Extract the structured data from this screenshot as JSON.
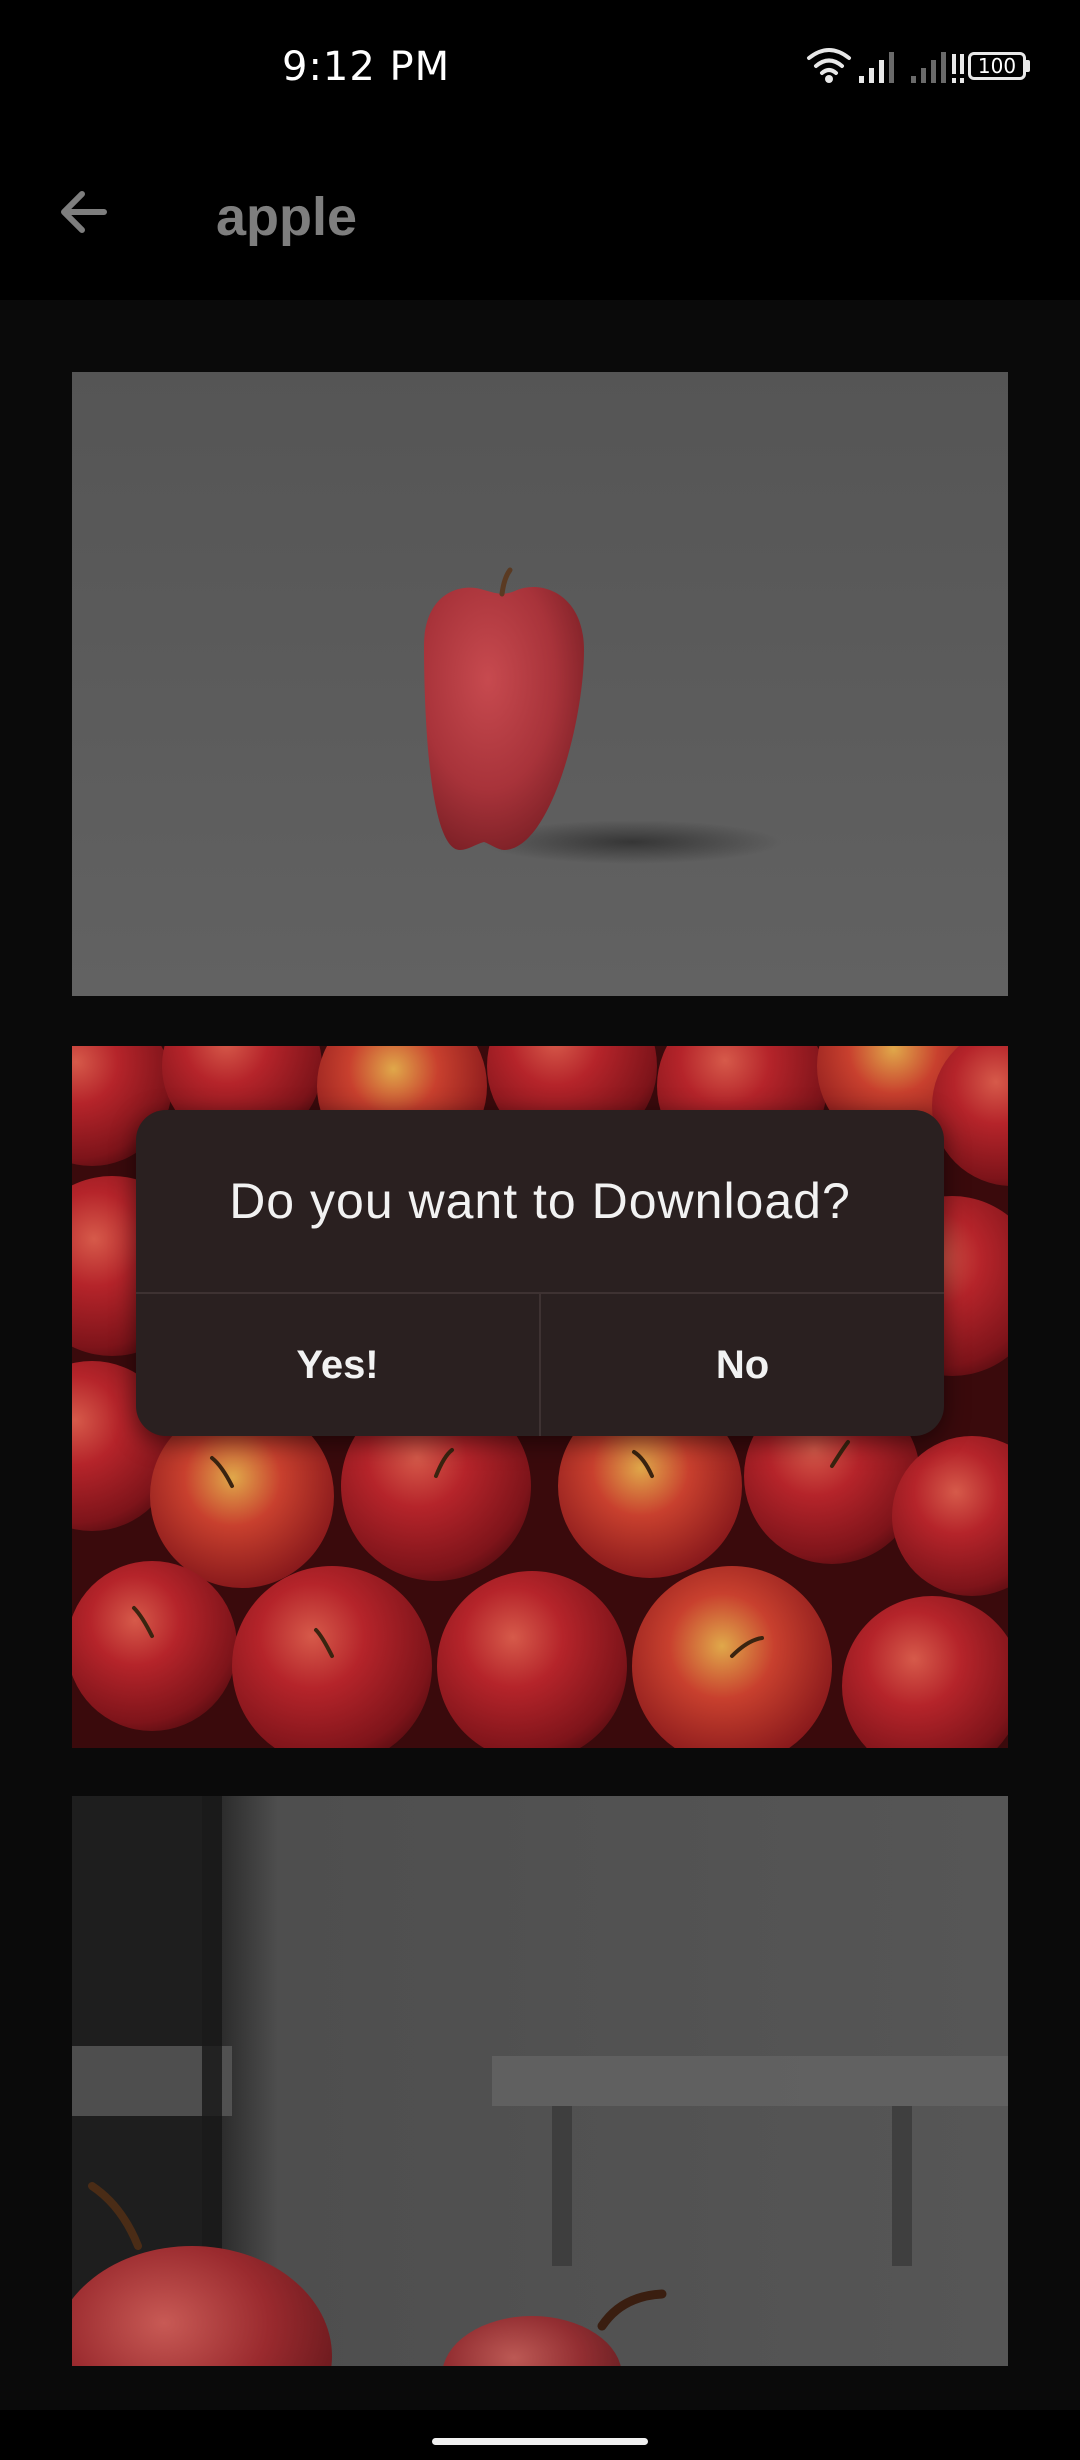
{
  "status_bar": {
    "time": "9:12 PM",
    "battery": "100",
    "icons": [
      "wifi-icon",
      "signal-icon",
      "signal-icon",
      "battery-icon"
    ]
  },
  "app_bar": {
    "title": "apple",
    "back_icon": "arrow-back-icon"
  },
  "images": [
    {
      "name": "single red apple on grey background"
    },
    {
      "name": "pile of red apples"
    },
    {
      "name": "apples on table in room"
    }
  ],
  "dialog": {
    "title": "Do you want to Download?",
    "yes_label": "Yes!",
    "no_label": "No"
  },
  "colors": {
    "dialog_bg": "#2a2020",
    "title_text": "#7e7e7e",
    "background": "#0a0a0a"
  }
}
